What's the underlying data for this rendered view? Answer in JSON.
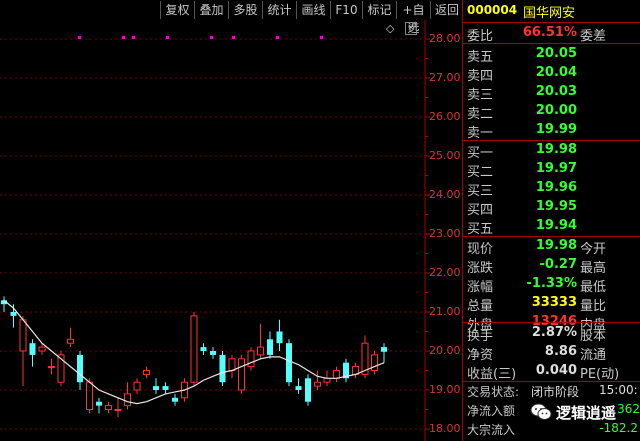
{
  "toolbar": {
    "buttons": [
      "复权",
      "叠加",
      "多股",
      "统计",
      "画线",
      "F10",
      "标记",
      "+自选",
      "返回"
    ]
  },
  "chart": {
    "axis_labels": [
      "28.00",
      "27.00",
      "26.00",
      "25.00",
      "24.00",
      "23.00",
      "22.00",
      "21.00",
      "20.00",
      "19.00",
      "18.00"
    ],
    "close_glyph": "×",
    "diamond_glyph": "◇"
  },
  "chart_data": {
    "type": "candlestick",
    "ylim": [
      18.0,
      28.0
    ],
    "grid": true,
    "candles": [
      {
        "o": 21.3,
        "c": 21.2,
        "h": 21.4,
        "l": 21.0
      },
      {
        "o": 21.0,
        "c": 20.9,
        "h": 21.2,
        "l": 20.6
      },
      {
        "o": 20.0,
        "c": 20.8,
        "h": 20.9,
        "l": 19.1
      },
      {
        "o": 20.2,
        "c": 19.9,
        "h": 20.3,
        "l": 19.6
      },
      {
        "o": 20.0,
        "c": 20.1,
        "h": 20.2,
        "l": 19.9
      },
      {
        "o": 19.6,
        "c": 19.6,
        "h": 19.8,
        "l": 19.4
      },
      {
        "o": 19.2,
        "c": 19.9,
        "h": 20.0,
        "l": 19.1
      },
      {
        "o": 20.2,
        "c": 20.3,
        "h": 20.6,
        "l": 20.1
      },
      {
        "o": 19.9,
        "c": 19.2,
        "h": 20.0,
        "l": 19.0
      },
      {
        "o": 18.5,
        "c": 19.2,
        "h": 19.3,
        "l": 18.4
      },
      {
        "o": 18.7,
        "c": 18.6,
        "h": 18.8,
        "l": 18.4
      },
      {
        "o": 18.5,
        "c": 18.6,
        "h": 18.7,
        "l": 18.4
      },
      {
        "o": 18.5,
        "c": 18.5,
        "h": 18.8,
        "l": 18.3
      },
      {
        "o": 18.6,
        "c": 18.9,
        "h": 19.2,
        "l": 18.5
      },
      {
        "o": 19.0,
        "c": 19.2,
        "h": 19.3,
        "l": 18.9
      },
      {
        "o": 19.4,
        "c": 19.5,
        "h": 19.6,
        "l": 19.3
      },
      {
        "o": 19.1,
        "c": 19.0,
        "h": 19.3,
        "l": 18.9
      },
      {
        "o": 19.1,
        "c": 19.0,
        "h": 19.2,
        "l": 18.9
      },
      {
        "o": 18.8,
        "c": 18.7,
        "h": 18.9,
        "l": 18.6
      },
      {
        "o": 18.8,
        "c": 19.2,
        "h": 19.3,
        "l": 18.7
      },
      {
        "o": 19.2,
        "c": 20.9,
        "h": 21.0,
        "l": 19.1
      },
      {
        "o": 20.1,
        "c": 20.0,
        "h": 20.2,
        "l": 19.9
      },
      {
        "o": 20.0,
        "c": 19.9,
        "h": 20.1,
        "l": 19.8
      },
      {
        "o": 19.9,
        "c": 19.2,
        "h": 20.0,
        "l": 19.1
      },
      {
        "o": 19.5,
        "c": 19.8,
        "h": 19.9,
        "l": 19.3
      },
      {
        "o": 19.0,
        "c": 19.8,
        "h": 19.9,
        "l": 18.9
      },
      {
        "o": 19.6,
        "c": 20.0,
        "h": 20.1,
        "l": 19.5
      },
      {
        "o": 19.9,
        "c": 20.1,
        "h": 20.7,
        "l": 19.8
      },
      {
        "o": 20.3,
        "c": 19.9,
        "h": 20.5,
        "l": 19.8
      },
      {
        "o": 20.5,
        "c": 20.2,
        "h": 20.8,
        "l": 20.0
      },
      {
        "o": 20.2,
        "c": 19.2,
        "h": 20.3,
        "l": 19.1
      },
      {
        "o": 19.1,
        "c": 19.0,
        "h": 19.3,
        "l": 18.9
      },
      {
        "o": 19.3,
        "c": 18.7,
        "h": 19.4,
        "l": 18.6
      },
      {
        "o": 19.1,
        "c": 19.2,
        "h": 19.5,
        "l": 19.0
      },
      {
        "o": 19.2,
        "c": 19.3,
        "h": 19.5,
        "l": 19.1
      },
      {
        "o": 19.3,
        "c": 19.5,
        "h": 19.6,
        "l": 19.2
      },
      {
        "o": 19.7,
        "c": 19.3,
        "h": 19.8,
        "l": 19.2
      },
      {
        "o": 19.4,
        "c": 19.6,
        "h": 19.7,
        "l": 19.3
      },
      {
        "o": 19.4,
        "c": 20.2,
        "h": 20.4,
        "l": 19.3
      },
      {
        "o": 19.5,
        "c": 19.9,
        "h": 20.0,
        "l": 19.4
      },
      {
        "o": 20.1,
        "c": 19.98,
        "h": 20.2,
        "l": 19.7
      }
    ],
    "ma": [
      21.3,
      21.1,
      20.8,
      20.5,
      20.2,
      20.0,
      19.8,
      19.6,
      19.4,
      19.2,
      19.0,
      18.9,
      18.8,
      18.7,
      18.65,
      18.7,
      18.8,
      18.9,
      18.95,
      19.0,
      19.1,
      19.25,
      19.35,
      19.45,
      19.5,
      19.6,
      19.7,
      19.8,
      19.85,
      19.85,
      19.75,
      19.65,
      19.5,
      19.35,
      19.3,
      19.3,
      19.35,
      19.4,
      19.5,
      19.6,
      19.7
    ]
  },
  "stock": {
    "code": "000004",
    "name": "国华网安"
  },
  "quote": {
    "weibi_label": "委比",
    "weibi_value": "66.51%",
    "weicha_label": "委差",
    "sell": [
      {
        "label": "卖五",
        "price": "20.05"
      },
      {
        "label": "卖四",
        "price": "20.04"
      },
      {
        "label": "卖三",
        "price": "20.03"
      },
      {
        "label": "卖二",
        "price": "20.00"
      },
      {
        "label": "卖一",
        "price": "19.99"
      }
    ],
    "buy": [
      {
        "label": "买一",
        "price": "19.98"
      },
      {
        "label": "买二",
        "price": "19.97"
      },
      {
        "label": "买三",
        "price": "19.96"
      },
      {
        "label": "买四",
        "price": "19.95"
      },
      {
        "label": "买五",
        "price": "19.94"
      }
    ],
    "stats": [
      {
        "label": "现价",
        "value": "19.98",
        "label2": "今开",
        "color": "green"
      },
      {
        "label": "涨跌",
        "value": "-0.27",
        "label2": "最高",
        "color": "green"
      },
      {
        "label": "涨幅",
        "value": "-1.33%",
        "label2": "最低",
        "color": "green"
      },
      {
        "label": "总量",
        "value": "33333",
        "label2": "量比",
        "color": "yellow"
      },
      {
        "label": "外盘",
        "value": "13246",
        "label2": "内盘",
        "color": "red"
      }
    ],
    "stats2": [
      {
        "label": "换手",
        "value": "2.87%",
        "label2": "股本",
        "color": "white"
      },
      {
        "label": "净资",
        "value": "8.86",
        "label2": "流通",
        "color": "white"
      },
      {
        "label": "收益(三)",
        "value": "0.040",
        "label2": "PE(动)",
        "color": "white"
      }
    ],
    "status_label": "交易状态:",
    "status_value": "闭市阶段",
    "status_time": "15:00:",
    "netflow_label": "净流入额",
    "netflow_value": "362",
    "block_label": "大宗流入",
    "block_value": "-182.2"
  },
  "watermark": {
    "text": "逻辑逍遥"
  }
}
